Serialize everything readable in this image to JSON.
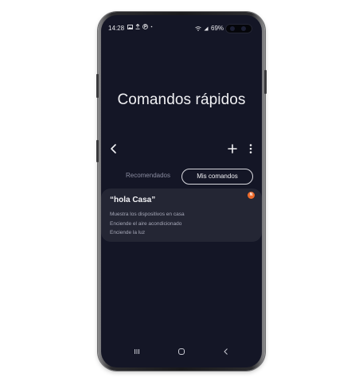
{
  "status_bar": {
    "time": "14:28",
    "left_icons": [
      "image-icon",
      "upload-icon",
      "p-circle-icon",
      "dot-icon"
    ],
    "battery_text": "69%",
    "right_icons": [
      "wifi-icon",
      "signal-icon",
      "battery-icon"
    ]
  },
  "page": {
    "title": "Comandos rápidos"
  },
  "toolbar": {
    "icons": [
      "back-chevron-icon",
      "plus-icon",
      "more-vertical-icon"
    ]
  },
  "tabs": [
    {
      "label": "Recomendados",
      "selected": false
    },
    {
      "label": "Mis comandos",
      "selected": true
    }
  ],
  "command_card": {
    "title": "“hola Casa”",
    "badge": "N",
    "badge_color": "#ec6a2b",
    "actions": [
      "Muestra los dispositivos en casa",
      "Enciende el aire acondicionado",
      "Enciende la luz"
    ]
  },
  "nav_bar": {
    "icons": [
      "recents-icon",
      "home-icon",
      "back-icon"
    ]
  },
  "colors": {
    "screen_background": "#141626",
    "card_background": "#242634",
    "text_primary": "#f1f1f4",
    "text_secondary": "#a6a8b8"
  }
}
